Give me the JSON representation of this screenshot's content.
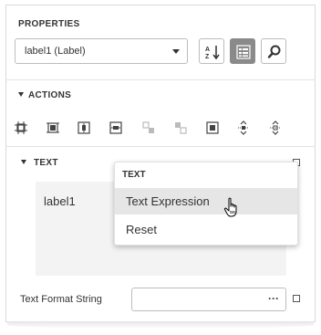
{
  "properties": {
    "title": "PROPERTIES",
    "selected_component": "label1 (Label)",
    "icons": [
      "sort-alphabetical-icon",
      "categorized-view-icon",
      "search-icon"
    ]
  },
  "actions": {
    "title": "ACTIONS",
    "icons": [
      "align-left-edges-icon",
      "size-to-grid-icon",
      "center-horizontally-icon",
      "center-vertically-icon",
      "bring-forward-icon",
      "send-backward-icon",
      "fit-to-container-icon",
      "vertical-spacing-icon",
      "horizontal-spacing-icon"
    ]
  },
  "text_section": {
    "title": "TEXT",
    "value": "label1"
  },
  "context_menu": {
    "title": "TEXT",
    "items": [
      {
        "label": "Text Expression",
        "hovered": true
      },
      {
        "label": "Reset",
        "hovered": false
      }
    ]
  },
  "text_format": {
    "label": "Text Format String",
    "value": "",
    "button_label": "···"
  },
  "colors": {
    "active_button": "#8a8a8a",
    "border": "#bdbdbd",
    "text_area_bg": "#f3f3f3",
    "hover_bg": "#e6e6e6"
  }
}
